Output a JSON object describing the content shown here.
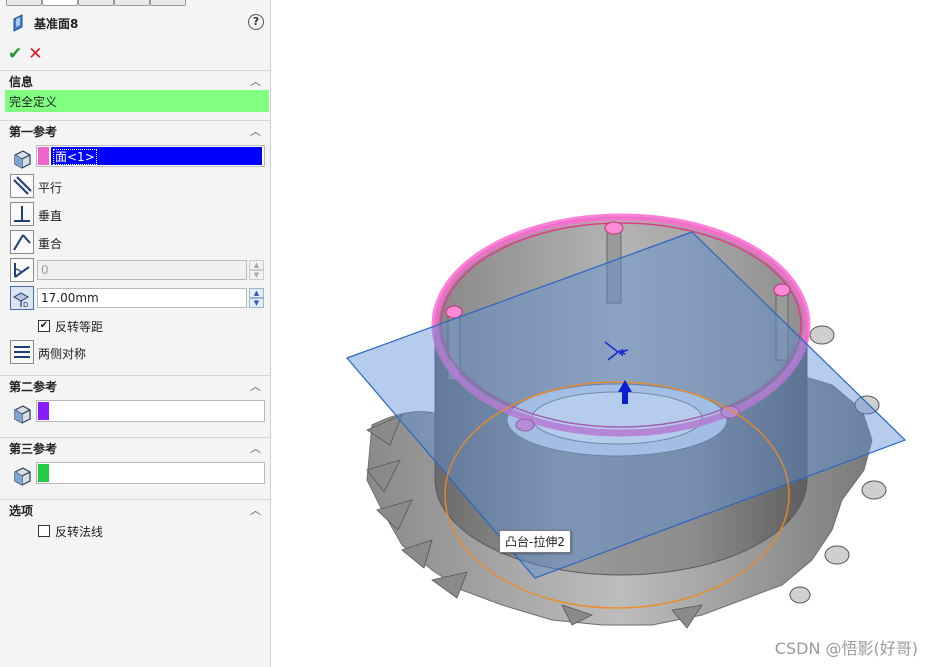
{
  "feature": {
    "title": "基准面8",
    "help_label": "?"
  },
  "sections": {
    "info": {
      "label": "信息",
      "status": "完全定义",
      "status_color": "#80ff80"
    },
    "first_ref": {
      "label": "第一参考",
      "selection": "面<1>",
      "swatch_color": "#ee66cc",
      "options": [
        {
          "label": "平行"
        },
        {
          "label": "垂直"
        },
        {
          "label": "重合"
        }
      ],
      "angle_value": "0",
      "offset_value": "17.00mm",
      "reverse_offset_label": "反转等距",
      "reverse_offset_checked": true,
      "symmetric_label": "两侧对称"
    },
    "second_ref": {
      "label": "第二参考",
      "swatch_color": "#8a1aff"
    },
    "third_ref": {
      "label": "第三参考",
      "swatch_color": "#22cc44"
    },
    "options": {
      "label": "选项",
      "flip_normal_label": "反转法线",
      "flip_normal_checked": false
    }
  },
  "viewport": {
    "tooltip": "凸台-拉伸2",
    "watermark": "CSDN @悟影(好哥)"
  }
}
